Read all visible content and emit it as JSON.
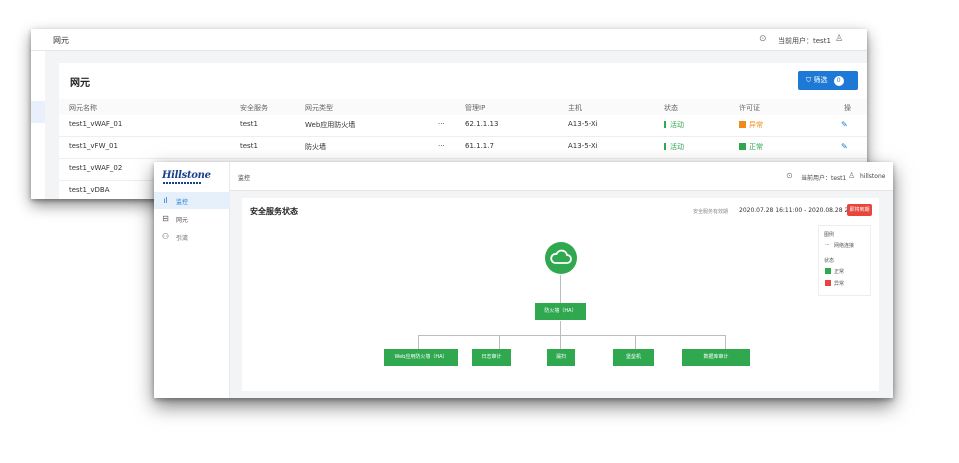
{
  "back_window": {
    "topbar_title": "网元",
    "current_user_label": "当前用户：test1",
    "panel_title": "网元",
    "filter_button": "筛选",
    "filter_count": "0",
    "columns": [
      "网元名称",
      "安全服务",
      "网元类型",
      "管理IP",
      "主机",
      "状态",
      "许可证",
      "操"
    ],
    "rows": [
      {
        "name": "test1_vWAF_01",
        "service": "test1",
        "type": "Web应用防火墙",
        "more": "···",
        "ip": "62.1.1.13",
        "host": "A13-5-Xi",
        "status": "活动",
        "license": "异常",
        "license_state": "warn"
      },
      {
        "name": "test1_vFW_01",
        "service": "test1",
        "type": "防火墙",
        "more": "···",
        "ip": "61.1.1.7",
        "host": "A13-5-Xi",
        "status": "活动",
        "license": "正常",
        "license_state": "ok"
      },
      {
        "name": "test1_vWAF_02",
        "service": "",
        "type": "",
        "more": "",
        "ip": "",
        "host": "",
        "status": "",
        "license": "",
        "license_state": ""
      },
      {
        "name": "test1_vDBA",
        "service": "",
        "type": "",
        "more": "",
        "ip": "",
        "host": "",
        "status": "",
        "license": "",
        "license_state": ""
      }
    ]
  },
  "front_window": {
    "logo": "Hillstone",
    "nav": [
      {
        "label": "监控",
        "icon": "bar-chart-icon",
        "active": true
      },
      {
        "label": "网元",
        "icon": "server-icon",
        "active": false
      },
      {
        "label": "引流",
        "icon": "flow-icon",
        "active": false
      }
    ],
    "topbar_title": "监控",
    "current_user_label": "当前用户：test1",
    "user_name": "hillstone",
    "panel_title": "安全服务状态",
    "period_label": "安全服务有效期",
    "period_value": "2020.07.28 16:11:00 - 2020.08.28 23:59:59",
    "period_button": "即将到期",
    "legend": {
      "section1": "图例",
      "item_link": "网络连接",
      "section2": "状态",
      "item_normal": "正常",
      "item_abnormal": "异常"
    },
    "topology": {
      "root_node": "防火墙（HA）",
      "children": [
        "Web应用防火墙（HA）",
        "日志审计",
        "堡垒机",
        "漏扫",
        "数据库审计"
      ]
    },
    "colors": {
      "node_green": "#2fa84f",
      "alert_red": "#e8453c",
      "primary_blue": "#1e78d6"
    }
  }
}
